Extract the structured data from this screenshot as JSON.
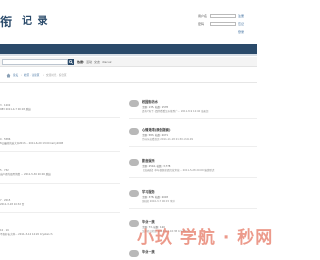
{
  "header": {
    "logo_mark": "衔",
    "logo_text": "记 录",
    "login": {
      "username_label": "用户名",
      "password_label": "密码",
      "remember_label": "注册",
      "login_link": "登录",
      "register_link": "忘记"
    }
  },
  "search": {
    "hot_label": "热搜:",
    "hot_items": [
      "活动",
      "交友",
      "discuz"
    ]
  },
  "breadcrumb": {
    "items": [
      "论坛",
      "社区 · 讨论区",
      "交流时光 · 综合区"
    ]
  },
  "colors": {
    "nav": "#2a4a6a",
    "watermark": "#e67864"
  },
  "left_column": [
    {
      "stats": "3 · 1202",
      "last": "983 2011-4-7 00:18 脱缺"
    },
    {
      "stats": "0 · 5586",
      "last": "8公最终的选大众2013... 2011-6-29 13:00 kerry2008"
    },
    {
      "stats": "5 · 732",
      "last": "出产者的使用消费 ... 2011-5-30 20:00 脱缺"
    },
    {
      "stats": "7 · 2015",
      "last": "2011-3-18 10:32 百"
    },
    {
      "stats": "10 · 19",
      "last": "不喜好长大体... 2011-3-14 14:20 Crystal.ch"
    }
  ],
  "forums": [
    {
      "title": "校园街坊水",
      "stats": "主题: 135, 帖数: 1578",
      "last": "还有7天了, 四所看看怎么能到广... 2011-8-9 12:40 海无涯"
    },
    {
      "title": "心情港湾(原创版面)",
      "stats": "主题: 583, 帖数: 2071",
      "last": "为什么抗看首页 2011-11-18 21:30 ohdi.09"
    },
    {
      "title": "影音娱乐",
      "stats": "主题: 2544, 帖数: 3,778",
      "last": "【高画质】中年视频全面完就复就... 2011-5-28 20:09 脑袋壁虎"
    },
    {
      "title": "学习服务",
      "stats": "主题: 378, 帖数: 2003",
      "last": "[原创] 2010-3-7 00:15 李洋"
    },
    {
      "title": "毕业一族",
      "stats": "主题: 73, 帖数: 120",
      "last": "怎样转公积金 2011-3-1 16:38 Crystal.ch"
    },
    {
      "title": "毕业一族",
      "stats": "",
      "last": ""
    }
  ],
  "watermark": "小玖 学航 · 秒网"
}
